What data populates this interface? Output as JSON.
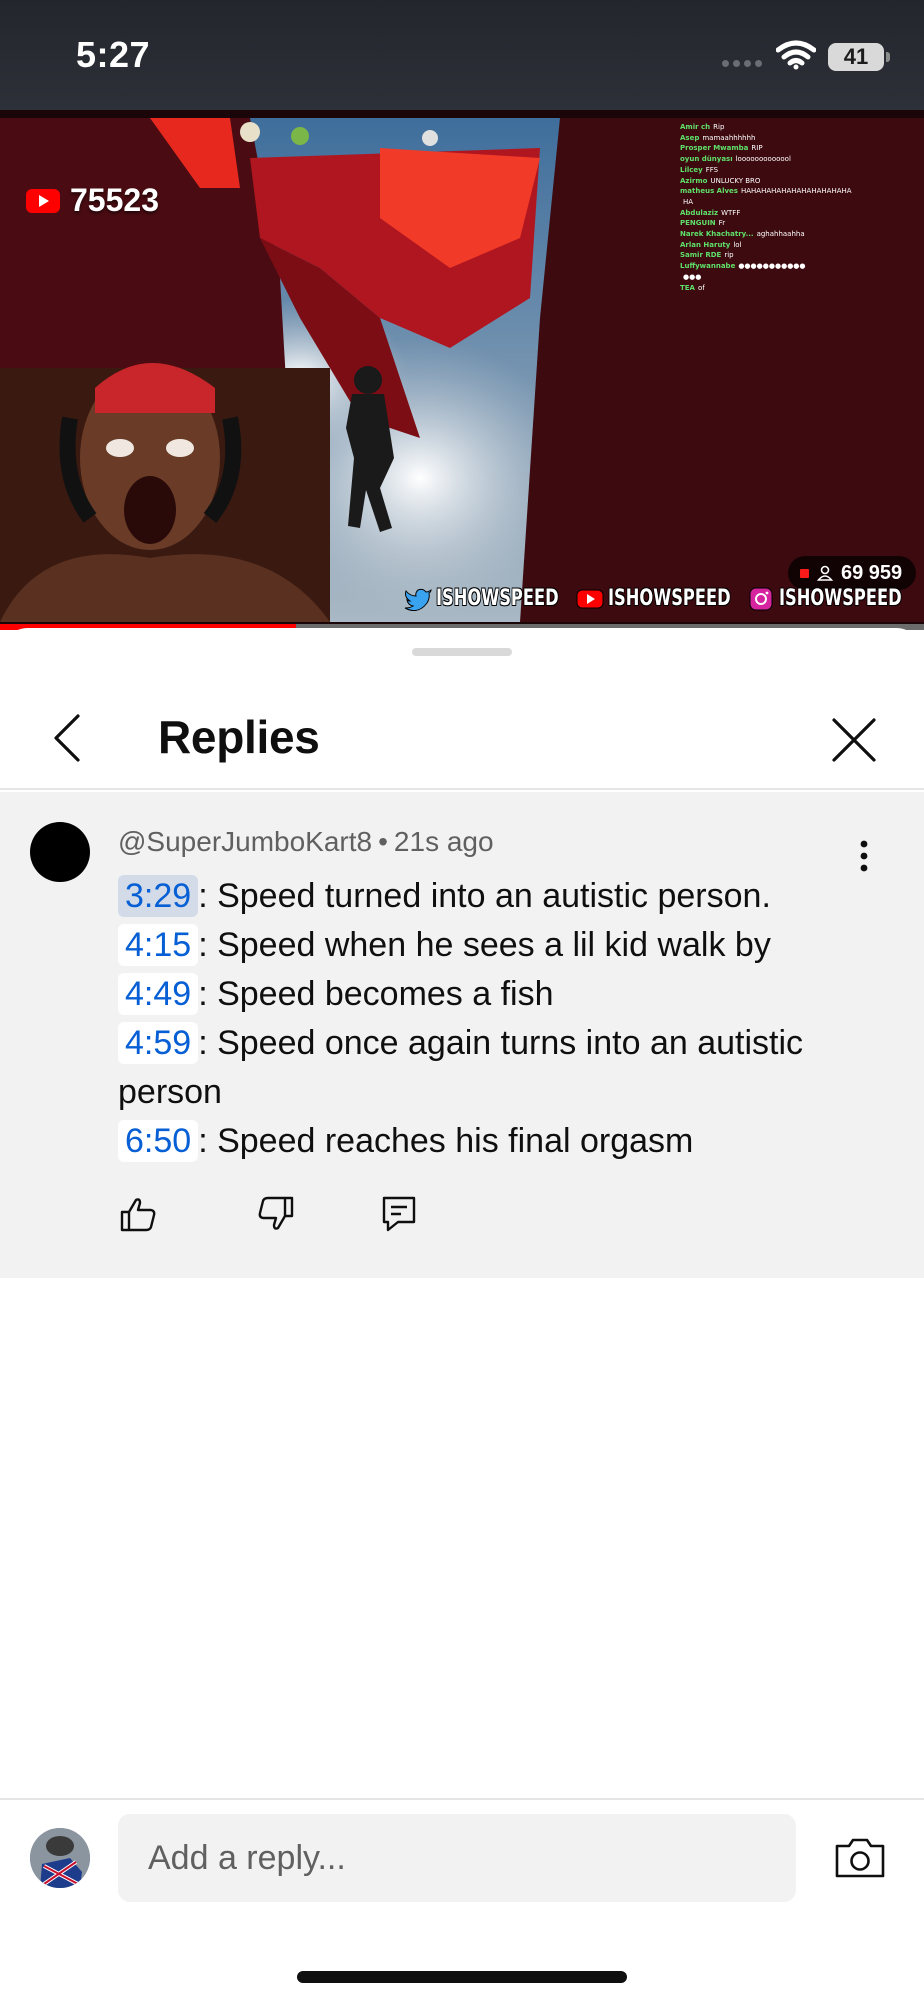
{
  "status_bar": {
    "time": "5:27",
    "battery": "41",
    "icons": [
      "cellular-dots-icon",
      "wifi-icon",
      "battery-icon"
    ]
  },
  "video": {
    "subscriber_count": "75523",
    "viewers": "69 959",
    "progress_fraction": 0.32,
    "socials": [
      "ISHOWSPEED",
      "ISHOWSPEED",
      "ISHOWSPEED"
    ],
    "social_icons": [
      "twitter-icon",
      "youtube-icon",
      "instagram-icon"
    ],
    "chat": [
      {
        "user": "Amir ch",
        "msg": "Rip"
      },
      {
        "user": "Asep",
        "msg": "mamaahhhhhh"
      },
      {
        "user": "Prosper Mwamba",
        "msg": "RIP"
      },
      {
        "user": "oyun dünyası",
        "msg": "looooooooooool"
      },
      {
        "user": "Lilcey",
        "msg": "FFS"
      },
      {
        "user": "Azirmo",
        "msg": "UNLUCKY BRO"
      },
      {
        "user": "matheus Alves",
        "msg": "HAHAHAHAHAHAHAHAHAHAHA"
      },
      {
        "user": "",
        "msg": "HA"
      },
      {
        "user": "Abdulaziz",
        "msg": "WTFF"
      },
      {
        "user": "PENGUIN",
        "msg": "Fr"
      },
      {
        "user": "Narek Khachatry...",
        "msg": "aghahhaahha"
      },
      {
        "user": "Arlan Haruty",
        "msg": "lol"
      },
      {
        "user": "Samir RDE",
        "msg": "rip"
      },
      {
        "user": "Luffywannabe",
        "msg": "●●●●●●●●●●●"
      },
      {
        "user": "",
        "msg": "●●●"
      },
      {
        "user": "TEA",
        "msg": "of"
      }
    ]
  },
  "panel": {
    "title": "Replies"
  },
  "comment": {
    "author": "@SuperJumboKart8",
    "separator": "•",
    "time_ago": "21s ago",
    "lines": [
      {
        "timestamp": "3:29",
        "text": ": Speed turned into an autistic person."
      },
      {
        "timestamp": "4:15",
        "text": ": Speed when he sees a lil kid walk by"
      },
      {
        "timestamp": "4:49",
        "text": ": Speed becomes a fish"
      },
      {
        "timestamp": "4:59",
        "text": ": Speed once again turns into an autistic person"
      },
      {
        "timestamp": "6:50",
        "text": ": Speed reaches his final orgasm"
      }
    ],
    "actions": [
      "thumbs-up-icon",
      "thumbs-down-icon",
      "reply-icon"
    ]
  },
  "reply_bar": {
    "placeholder": "Add a reply..."
  },
  "colors": {
    "link_blue": "#065fd4",
    "timestamp_highlight": "#d2dbe7",
    "comment_bg": "#f2f2f2",
    "progress_red": "#ff0000"
  }
}
